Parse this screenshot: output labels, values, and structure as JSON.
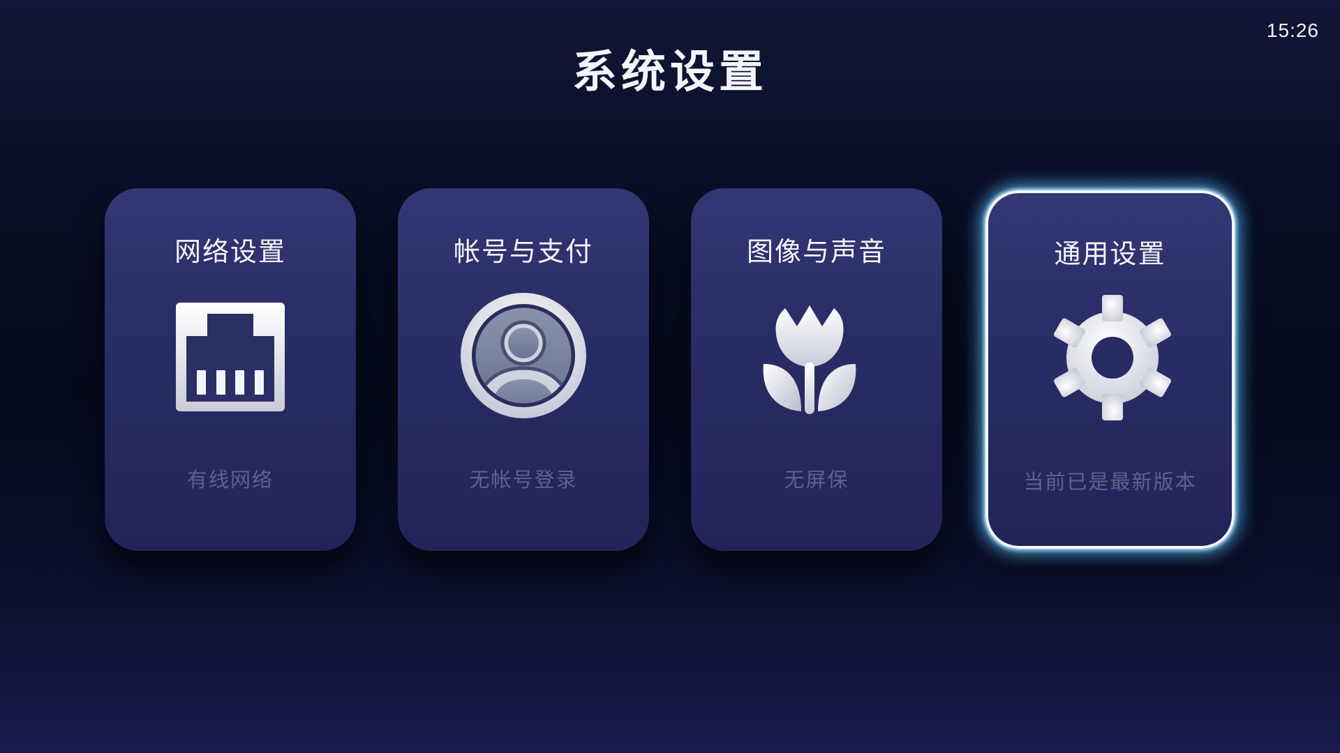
{
  "header": {
    "title": "系统设置",
    "clock": "15:26"
  },
  "cards": [
    {
      "title": "网络设置",
      "status": "有线网络",
      "icon": "ethernet-port-icon",
      "selected": false
    },
    {
      "title": "帐号与支付",
      "status": "无帐号登录",
      "icon": "user-account-icon",
      "selected": false
    },
    {
      "title": "图像与声音",
      "status": "无屏保",
      "icon": "tulip-flower-icon",
      "selected": false
    },
    {
      "title": "通用设置",
      "status": "当前已是最新版本",
      "icon": "gear-icon",
      "selected": true
    }
  ],
  "colors": {
    "background": "#080c22",
    "card": "#2a2d66",
    "focus_glow": "#8fd6ff",
    "status_text": "#5f6288"
  }
}
